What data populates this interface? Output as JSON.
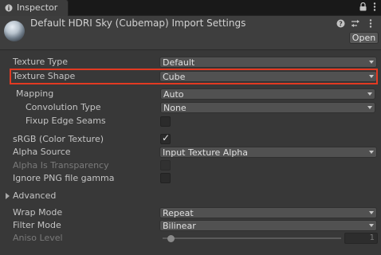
{
  "tab": {
    "label": "Inspector",
    "icon": "info-icon"
  },
  "tab_controls": {
    "lock_icon": "lock-icon",
    "menu_icon": "kebab-menu-icon"
  },
  "header": {
    "title": "Default HDRI Sky (Cubemap) Import Settings",
    "open_label": "Open",
    "icons": [
      "help-icon",
      "preset-icon",
      "more-icon"
    ]
  },
  "fields": {
    "texture_type": {
      "label": "Texture Type",
      "value": "Default"
    },
    "texture_shape": {
      "label": "Texture Shape",
      "value": "Cube"
    },
    "mapping": {
      "label": "Mapping",
      "value": "Auto"
    },
    "convolution_type": {
      "label": "Convolution Type",
      "value": "None"
    },
    "fixup_edge_seams": {
      "label": "Fixup Edge Seams",
      "checked": false
    },
    "srgb": {
      "label": "sRGB (Color Texture)",
      "checked": true
    },
    "alpha_source": {
      "label": "Alpha Source",
      "value": "Input Texture Alpha"
    },
    "alpha_is_transparency": {
      "label": "Alpha Is Transparency",
      "checked": false,
      "disabled": true
    },
    "ignore_png_gamma": {
      "label": "Ignore PNG file gamma",
      "checked": false
    },
    "advanced": {
      "label": "Advanced",
      "expanded": false
    },
    "wrap_mode": {
      "label": "Wrap Mode",
      "value": "Repeat"
    },
    "filter_mode": {
      "label": "Filter Mode",
      "value": "Bilinear"
    },
    "aniso_level": {
      "label": "Aniso Level",
      "value": "1",
      "fraction": 0.0,
      "disabled": true
    }
  },
  "colors": {
    "highlight": "#e23a22",
    "background": "#383838"
  }
}
